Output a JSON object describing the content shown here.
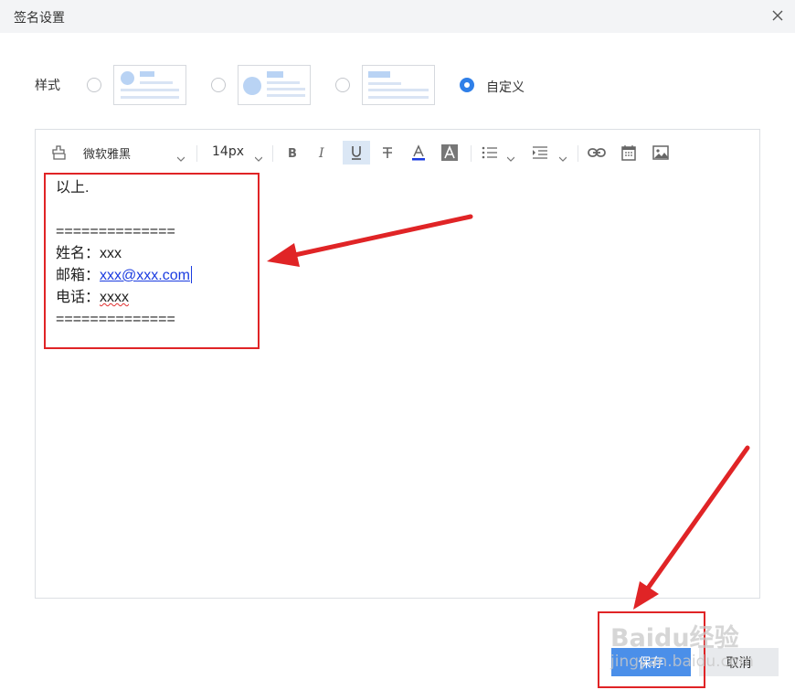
{
  "dialog": {
    "title": "签名设置",
    "close_icon": "close-icon"
  },
  "style_row": {
    "label": "样式",
    "options": [
      {
        "name": "style-1",
        "selected": false
      },
      {
        "name": "style-2",
        "selected": false
      },
      {
        "name": "style-3",
        "selected": false
      },
      {
        "name": "custom",
        "label": "自定义",
        "selected": true
      }
    ]
  },
  "toolbar": {
    "font_family": "微软雅黑",
    "font_size": "14px",
    "icons": [
      "format-painter-icon",
      "bold-icon",
      "italic-icon",
      "underline-icon",
      "strikethrough-icon",
      "font-color-icon",
      "background-color-icon",
      "list-icon",
      "indent-icon",
      "link-icon",
      "calendar-icon",
      "image-icon"
    ],
    "underline_active": true
  },
  "content": {
    "lines": [
      "以上.",
      "",
      "==============",
      "姓名：xxx",
      "邮箱：",
      "电话：",
      "=============="
    ],
    "email": "xxx@xxx.com",
    "phone": "xxxx"
  },
  "buttons": {
    "save": "保存",
    "cancel": "取消"
  },
  "watermark": {
    "brand": "Baidu经验",
    "url": "jingyan.baidu.com"
  },
  "colors": {
    "accent": "#4b8fe9",
    "annotation": "#e02426",
    "link": "#1a3be0"
  }
}
